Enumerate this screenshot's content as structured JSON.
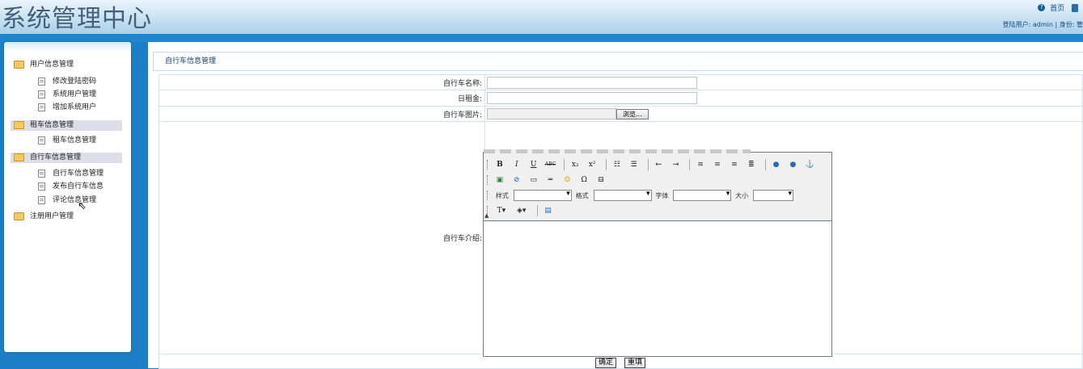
{
  "header": {
    "title": "系统管理中心",
    "home_link": "首页",
    "user_info": "登陆用户: admin | 身份: 管"
  },
  "sidebar": {
    "groups": [
      {
        "label": "用户信息管理",
        "items": [
          "修改登陆密码",
          "系统用户管理",
          "增加系统用户"
        ]
      },
      {
        "label": "租车信息管理",
        "items": [
          "租车信息管理"
        ]
      },
      {
        "label": "自行车信息管理",
        "items": [
          "自行车信息管理",
          "发布自行车信息",
          "评论信息管理"
        ]
      },
      {
        "label": "注册用户管理",
        "items": []
      }
    ]
  },
  "main": {
    "title": "自行车信息管理",
    "form": {
      "name_label": "自行车名称:",
      "rent_label": "日租金:",
      "image_label": "自行车图片:",
      "browse_label": "浏览...",
      "intro_label": "自行车介绍:"
    },
    "editor": {
      "style_label": "样式",
      "format_label": "格式",
      "font_label": "字体",
      "size_label": "大小"
    },
    "buttons": {
      "submit": "确定",
      "reset": "重填"
    }
  },
  "colors": {
    "background_blue": "#1d7fc6",
    "header_light": "#eaf4fb",
    "active_group_bg": "#dcdfe8"
  }
}
